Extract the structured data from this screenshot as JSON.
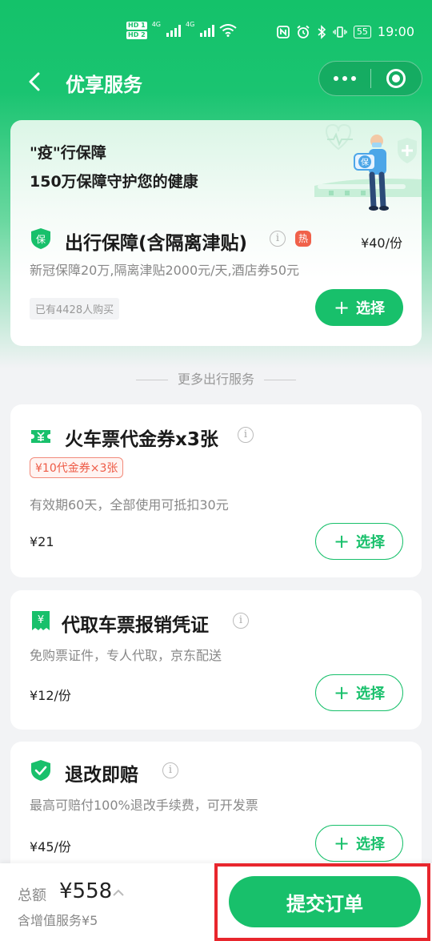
{
  "status_bar": {
    "hd1": "HD 1",
    "hd2": "HD 2",
    "sig1": "4G",
    "sig2": "4G",
    "battery": "55",
    "time": "19:00"
  },
  "nav": {
    "title": "优享服务"
  },
  "main_card": {
    "banner_line1": "\"疫\"行保障",
    "banner_line2": "150万保障守护您的健康",
    "illustration_badge": "保",
    "icon_glyph": "保",
    "title": "出行保障(含隔离津贴)",
    "hot_badge": "热",
    "price": "¥40/份",
    "description": "新冠保障20万,隔离津贴2000元/天,酒店券50元",
    "buyers": "已有4428人购买",
    "select_label": "选择"
  },
  "section_divider": "更多出行服务",
  "services": [
    {
      "title": "火车票代金券x3张",
      "coupon_tag": "¥10代金券×3张",
      "description": "有效期60天，全部使用可抵扣30元",
      "price": "¥21",
      "select_label": "选择"
    },
    {
      "title": "代取车票报销凭证",
      "icon_glyph": "¥",
      "description": "免购票证件，专人代取，京东配送",
      "price": "¥12/份",
      "select_label": "选择"
    },
    {
      "title": "退改即赔",
      "description": "最高可赔付100%退改手续费，可开发票",
      "price": "¥45/份",
      "select_label": "选择"
    }
  ],
  "bottom_bar": {
    "total_label": "总额",
    "total_value": "¥558",
    "addon_label": "含增值服务¥5",
    "submit_label": "提交订单"
  },
  "colors": {
    "brand_green": "#18c06b",
    "hot_red": "#f0614a",
    "highlight_red": "#e8262d"
  }
}
